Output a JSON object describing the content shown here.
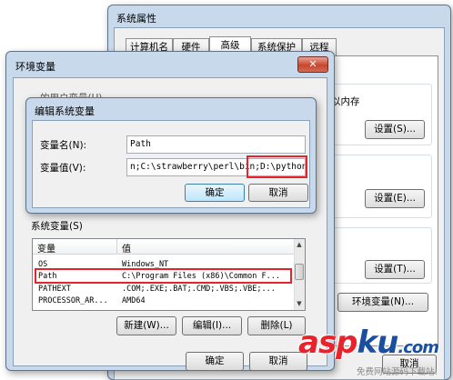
{
  "system_properties": {
    "title": "系统属性",
    "tabs": [
      "计算机名",
      "硬件",
      "高级",
      "系统保护",
      "远程"
    ],
    "active_tab": "高级",
    "memory_text": "以内存",
    "settings_buttons": [
      "设置(S)...",
      "设置(E)...",
      "设置(T)..."
    ],
    "env_button": "环境变量(N)...",
    "cancel_button": "取消"
  },
  "env_vars": {
    "title": "环境变量",
    "user_section_partial": "...的用户变量(U)",
    "system_section_label": "系统变量(S)",
    "columns": [
      "变量",
      "值"
    ],
    "rows": [
      {
        "name": "OS",
        "value": "Windows_NT"
      },
      {
        "name": "Path",
        "value": "C:\\Program Files (x86)\\Common F..."
      },
      {
        "name": "PATHEXT",
        "value": ".COM;.EXE;.BAT;.CMD;.VBS;.VBE;..."
      },
      {
        "name": "PROCESSOR_AR...",
        "value": "AMD64"
      }
    ],
    "highlighted_row": 1,
    "new_button": "新建(W)...",
    "edit_button": "编辑(I)...",
    "delete_button": "删除(L)",
    "ok_button": "确定",
    "cancel_button": "取消"
  },
  "edit_dialog": {
    "title": "编辑系统变量",
    "name_label": "变量名(N):",
    "name_value": "Path",
    "value_label": "变量值(V):",
    "value_value": "n;C:\\strawberry\\perl\\bin;D:\\python;",
    "ok_button": "确定",
    "cancel_button": "取消"
  },
  "watermark": {
    "brand_part1": "asp",
    "brand_part2": "ku",
    "brand_part3": ".com",
    "tagline": "免费网站源码下载站!"
  },
  "colors": {
    "highlight_red": "#e8232b",
    "watermark_red": "#e8232b",
    "watermark_blue": "#1a4fa0",
    "title_frame": "#c9d9ec"
  }
}
